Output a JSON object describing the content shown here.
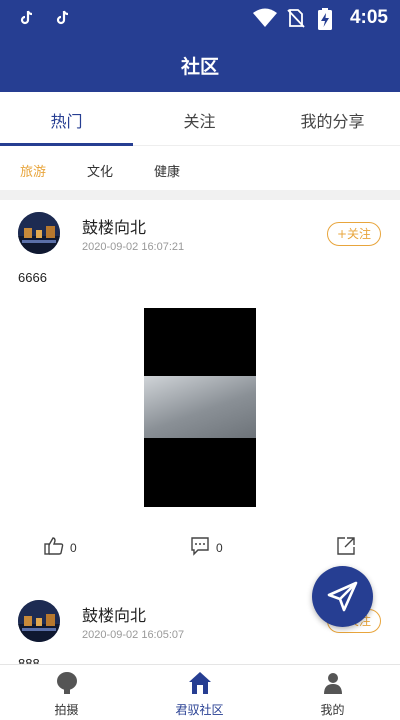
{
  "status_bar": {
    "time": "4:05"
  },
  "header": {
    "title": "社区"
  },
  "tabs": [
    {
      "label": "热门",
      "active": true
    },
    {
      "label": "关注",
      "active": false
    },
    {
      "label": "我的分享",
      "active": false
    }
  ],
  "categories": [
    {
      "label": "旅游",
      "active": true
    },
    {
      "label": "文化",
      "active": false
    },
    {
      "label": "健康",
      "active": false
    }
  ],
  "posts": [
    {
      "username": "鼓楼向北",
      "time": "2020-09-02 16:07:21",
      "follow_label": "+关注",
      "content": "6666",
      "likes": "0",
      "comments": "0"
    },
    {
      "username": "鼓楼向北",
      "time": "2020-09-02 16:05:07",
      "follow_label": "+关注",
      "content": "888"
    }
  ],
  "bottom_nav": [
    {
      "label": "拍摄",
      "icon": "camera-icon"
    },
    {
      "label": "君驭社区",
      "icon": "community-icon",
      "active": true
    },
    {
      "label": "我的",
      "icon": "profile-icon"
    }
  ],
  "colors": {
    "primary": "#263e92",
    "accent": "#e8a53c"
  }
}
